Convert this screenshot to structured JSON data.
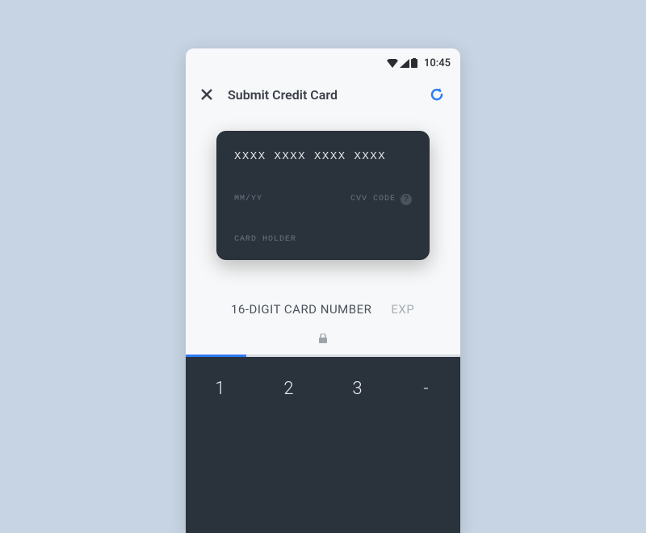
{
  "statusBar": {
    "time": "10:45"
  },
  "header": {
    "title": "Submit Credit Card"
  },
  "card": {
    "number": "XXXX XXXX XXXX XXXX",
    "expiry": "MM/YY",
    "cvv": "CVV CODE",
    "holder": "CARD HOLDER",
    "helpSymbol": "?"
  },
  "inputSection": {
    "cardNumberLabel": "16-DIGIT CARD NUMBER",
    "expiryLabel": "EXP"
  },
  "keypad": {
    "keys": [
      "1",
      "2",
      "3",
      "-"
    ]
  }
}
